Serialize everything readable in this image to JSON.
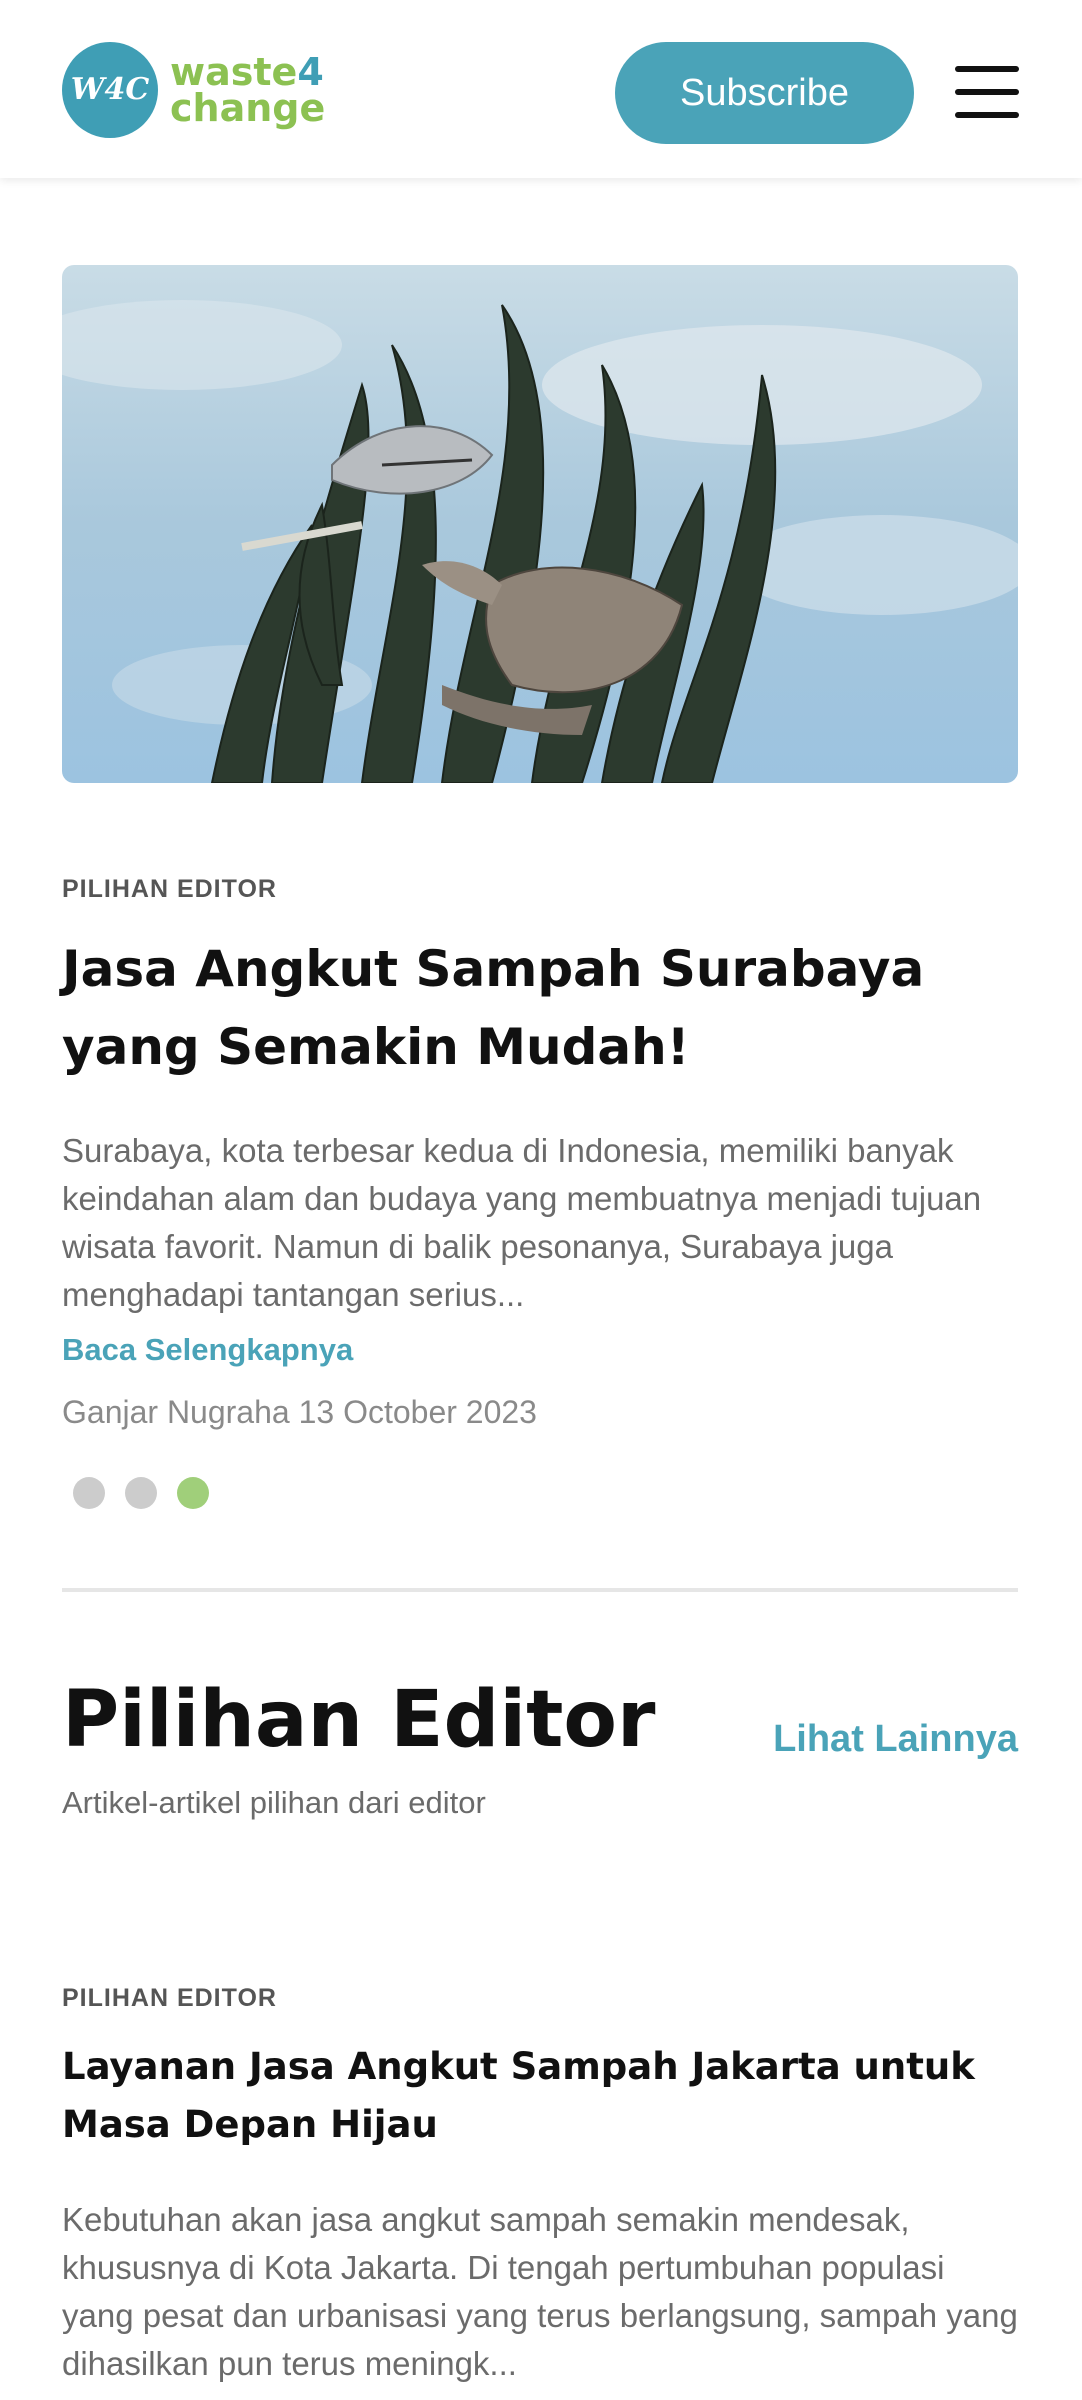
{
  "header": {
    "logo_mark": "W4C",
    "logo_line1": "waste",
    "logo_line1_num": "4",
    "logo_line2": "change",
    "subscribe_label": "Subscribe"
  },
  "featured": {
    "kicker": "PILIHAN EDITOR",
    "title": "Jasa Angkut Sampah Surabaya yang Semakin Mudah!",
    "excerpt": "Surabaya, kota terbesar kedua di Indonesia, memiliki banyak keindahan alam dan budaya yang membuatnya menjadi tujuan wisata favorit. Namun di balik pesonanya, Surabaya juga menghadapi tantangan serius...",
    "read_more": "Baca Selengkapnya",
    "author": "Ganjar Nugraha",
    "date": "13 October 2023",
    "image_icon": "shark-crocodile-statue-image",
    "carousel_active_index": 2,
    "carousel_count": 3
  },
  "section": {
    "title": "Pilihan Editor",
    "see_more": "Lihat Lainnya",
    "subtitle": "Artikel-artikel pilihan dari editor"
  },
  "articles": [
    {
      "kicker": "PILIHAN EDITOR",
      "title": "Layanan Jasa Angkut Sampah Jakarta untuk Masa Depan Hijau",
      "excerpt": "Kebutuhan akan jasa angkut sampah semakin mendesak, khususnya di Kota Jakarta. Di tengah pertumbuhan populasi yang pesat dan urbanisasi yang terus berlangsung, sampah yang dihasilkan pun terus meningk..."
    }
  ],
  "colors": {
    "brand_teal": "#4aa3b8",
    "brand_green": "#8cc152",
    "dot_active": "#a0cf7a",
    "dot_inactive": "#cccccc"
  }
}
